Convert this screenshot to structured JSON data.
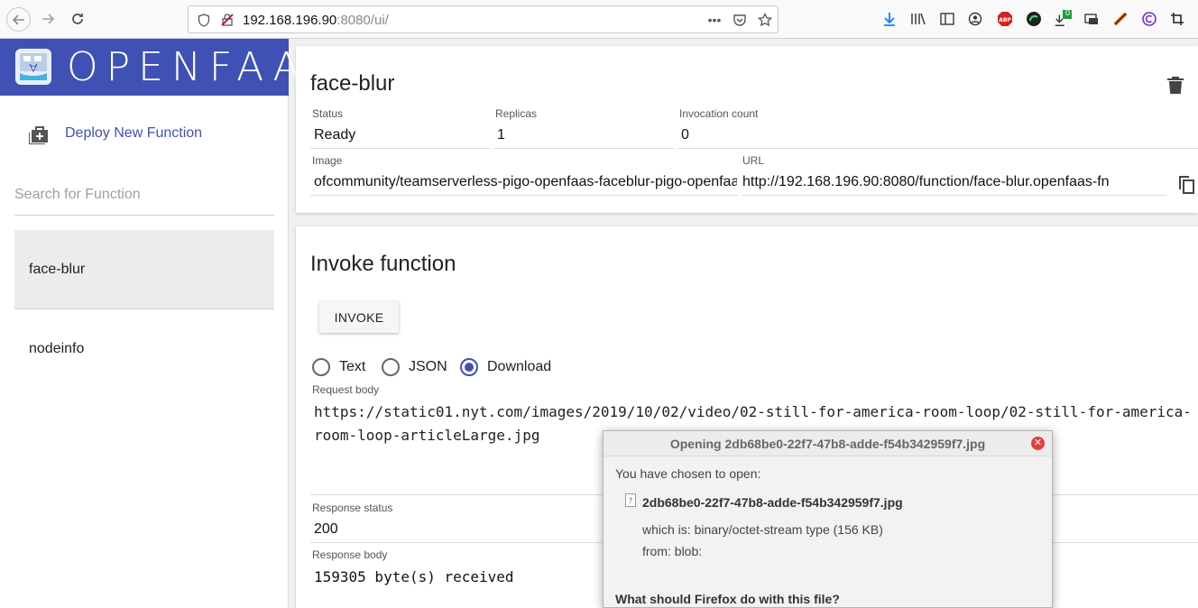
{
  "browser": {
    "url_host": "192.168.196.90",
    "url_rest": ":8080/ui/",
    "download_badge": "0"
  },
  "sidebar": {
    "logo_text": "OPENFAAS",
    "deploy_label": "Deploy New Function",
    "search_placeholder": "Search for Function",
    "functions": [
      {
        "name": "face-blur"
      },
      {
        "name": "nodeinfo"
      }
    ]
  },
  "function": {
    "title": "face-blur",
    "status_label": "Status",
    "status_value": "Ready",
    "replicas_label": "Replicas",
    "replicas_value": "1",
    "invocation_label": "Invocation count",
    "invocation_value": "0",
    "image_label": "Image",
    "image_value": "ofcommunity/teamserverless-pigo-openfaas-faceblur-pigo-openfaas-faceblur:latest",
    "url_label": "URL",
    "url_value": "http://192.168.196.90:8080/function/face-blur.openfaas-fn"
  },
  "invoke": {
    "title": "Invoke function",
    "button_label": "INVOKE",
    "options": [
      {
        "label": "Text",
        "checked": false
      },
      {
        "label": "JSON",
        "checked": false
      },
      {
        "label": "Download",
        "checked": true
      }
    ],
    "request_label": "Request body",
    "request_body": "https://static01.nyt.com/images/2019/10/02/video/02-still-for-america-room-loop/02-still-for-america-room-loop-articleLarge.jpg",
    "response_status_label": "Response status",
    "response_status": "200",
    "response_body_label": "Response body",
    "response_body": "159305 byte(s) received"
  },
  "dialog": {
    "title": "Opening 2db68be0-22f7-47b8-adde-f54b342959f7.jpg",
    "intro": "You have chosen to open:",
    "filename": "2db68be0-22f7-47b8-adde-f54b342959f7.jpg",
    "which_is": "which is: binary/octet-stream type (156 KB)",
    "from": "from: blob:",
    "question": "What should Firefox do with this file?"
  },
  "colors": {
    "brand": "#3f51b5",
    "close": "#e0403a"
  }
}
